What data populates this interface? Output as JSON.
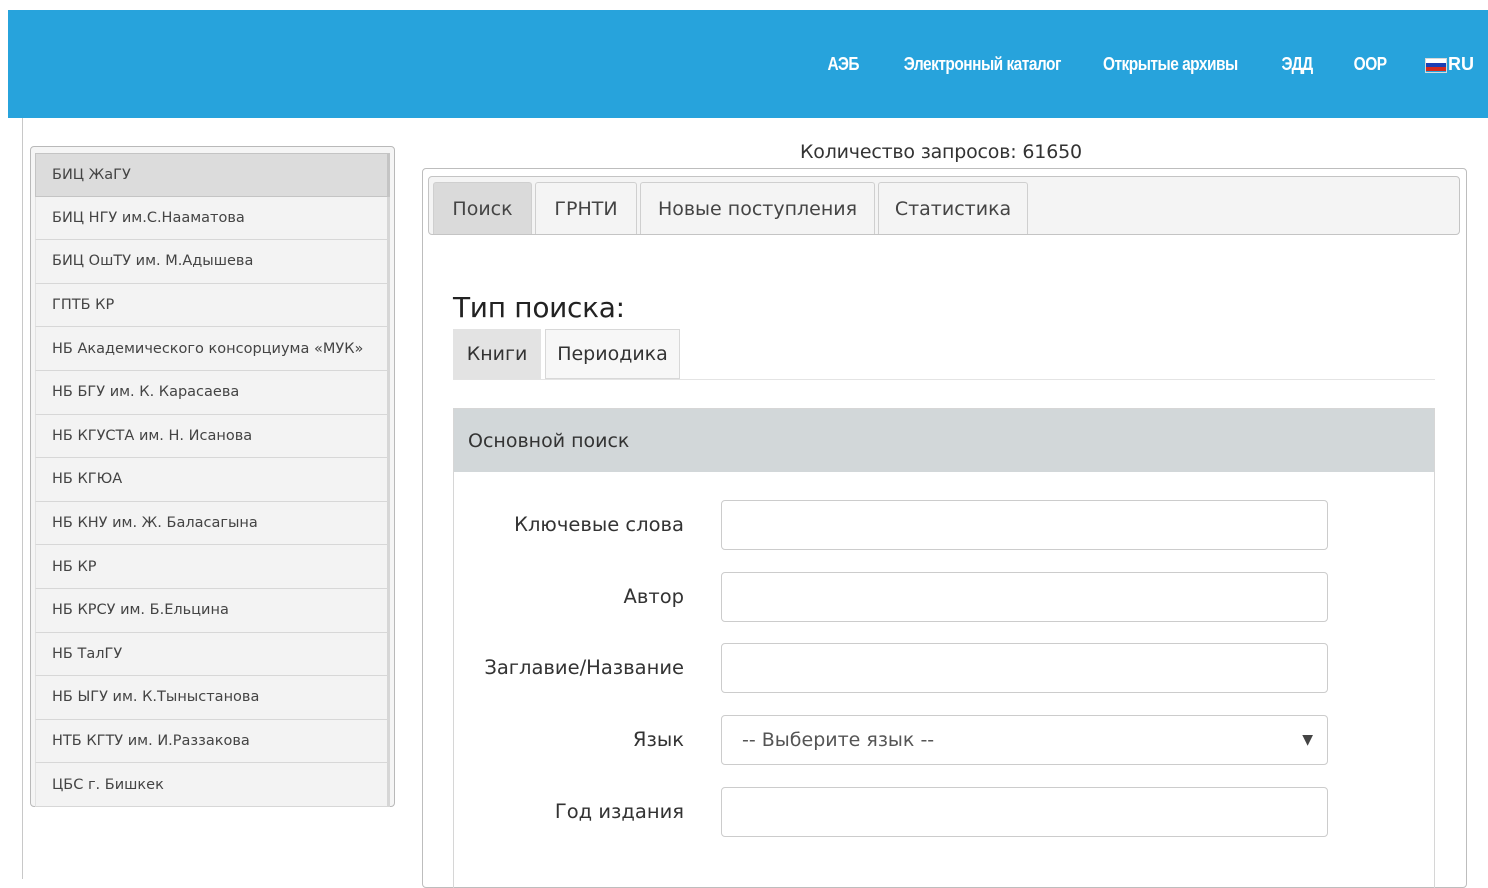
{
  "topnav": {
    "items": [
      "АЭБ",
      "Электронный каталог",
      "Открытые архивы",
      "ЭДД",
      "ООР"
    ],
    "lang": "RU",
    "flag_icon": "russian-flag-icon"
  },
  "sidebar": {
    "items": [
      {
        "label": "БИЦ ЖаГУ",
        "active": true
      },
      {
        "label": "БИЦ НГУ им.С.Нааматова"
      },
      {
        "label": "БИЦ ОшТУ им. М.Адышева"
      },
      {
        "label": "ГПТБ КР"
      },
      {
        "label": "НБ Академического консорциума «МУК»"
      },
      {
        "label": "НБ БГУ им. К. Карасаева"
      },
      {
        "label": "НБ КГУСТА им. Н. Исанова"
      },
      {
        "label": "НБ КГЮА"
      },
      {
        "label": "НБ КНУ им. Ж. Баласагына"
      },
      {
        "label": "НБ КР"
      },
      {
        "label": "НБ КРСУ им. Б.Ельцина"
      },
      {
        "label": "НБ ТалГУ"
      },
      {
        "label": "НБ ЫГУ им. К.Тыныстанова"
      },
      {
        "label": "НТБ КГТУ им. И.Раззакова"
      },
      {
        "label": "ЦБС г. Бишкек"
      }
    ]
  },
  "request_count": {
    "label": "Количество запросов:",
    "value": "61650"
  },
  "tabs": [
    "Поиск",
    "ГРНТИ",
    "Новые поступления",
    "Статистика"
  ],
  "search_type": {
    "title": "Тип поиска:",
    "tabs": [
      "Книги",
      "Периодика"
    ]
  },
  "panel": {
    "title": "Основной поиск",
    "fields": {
      "keywords": "Ключевые слова",
      "author": "Автор",
      "title": "Заглавие/Название",
      "language": "Язык",
      "year": "Год издания"
    },
    "language_select": "-- Выберите язык --"
  },
  "colors": {
    "header_bg": "#27a3dc",
    "panel_head_bg": "#d2d7d9"
  }
}
